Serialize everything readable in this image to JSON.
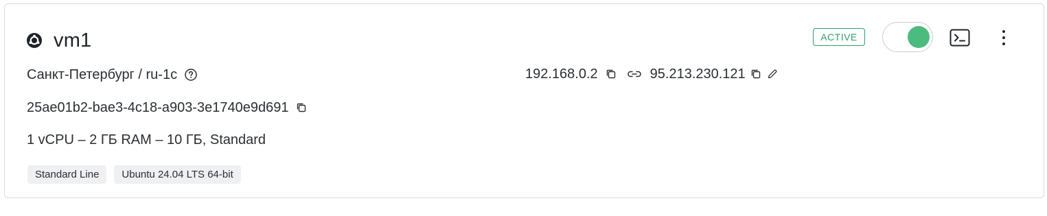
{
  "vm": {
    "name": "vm1",
    "location": "Санкт-Петербург / ru-1c",
    "uuid": "25ae01b2-bae3-4c18-a903-3e1740e9d691",
    "specs": "1 vCPU – 2 ГБ RAM – 10 ГБ, Standard",
    "status": "ACTIVE",
    "power_on": true,
    "private_ip": "192.168.0.2",
    "public_ip": "95.213.230.121",
    "tags": [
      "Standard Line",
      "Ubuntu 24.04 LTS 64-bit"
    ]
  },
  "icons": {
    "os": "ubuntu-icon",
    "help": "help-circle-icon",
    "copy": "copy-icon",
    "link": "link-icon",
    "edit": "pencil-icon",
    "console": "terminal-icon",
    "more": "more-vertical-icon"
  },
  "colors": {
    "active": "#2e9e6b",
    "toggle_on": "#4cbb7f",
    "tag_bg": "#eef0f2",
    "border": "#d9dce0"
  }
}
